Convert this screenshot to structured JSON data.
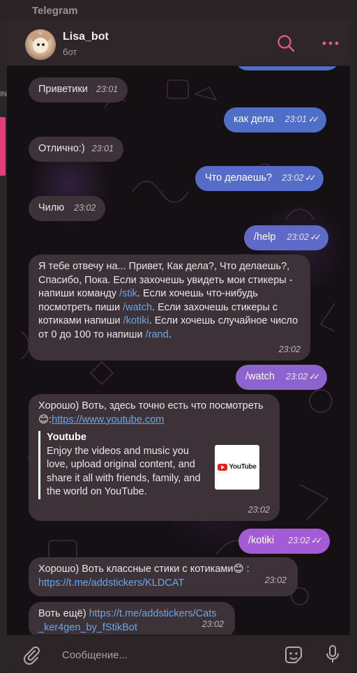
{
  "app": {
    "title": "Telegram"
  },
  "header": {
    "name": "Lisa_bot",
    "status": "бот",
    "search_icon": "search-icon",
    "menu_icon": "more-icon"
  },
  "colors": {
    "out_blue": "#4f6ec7",
    "out_purple": "#7a63c8",
    "out_violet": "#9f5cd4",
    "out_magenta": "#b45ed8",
    "incoming": "#3c3238",
    "accent_pink": "#e0407a"
  },
  "messages": [
    {
      "dir": "in",
      "text": "Приветики",
      "time": "23:01"
    },
    {
      "dir": "out",
      "text": "как дела",
      "time": "23:01"
    },
    {
      "dir": "in",
      "text": "Отлично:)",
      "time": "23:01"
    },
    {
      "dir": "out",
      "text": "Что делаешь?",
      "time": "23:02"
    },
    {
      "dir": "in",
      "text": "Чилю",
      "time": "23:02"
    },
    {
      "dir": "out",
      "text": "/help",
      "time": "23:02"
    },
    {
      "dir": "in",
      "time": "23:02",
      "parts": {
        "p1": "Я тебе отвечу на... Привет, Как дела?, Что делаешь?, Спасибо, Пока.  Если захочешь увидеть мои стикеры - напиши команду ",
        "c1": "/stik",
        "p2": ". Если хочешь что-нибудь посмотреть пиши ",
        "c2": "/watch",
        "p3": ". Если захочешь стикеры с котиками напиши ",
        "c3": "/kotiki",
        "p4": ". Если хочешь случайное число от 0 до 100 то напиши ",
        "c4": "/rand",
        "p5": "."
      }
    },
    {
      "dir": "out",
      "text": "/watch",
      "time": "23:02"
    },
    {
      "dir": "in",
      "time": "23:02",
      "text": "Хорошо) Воть, здесь точно есть что посмотреть",
      "emoji": "😊",
      "sep": ":",
      "url": "https://www.youtube.com",
      "preview": {
        "title": "Youtube",
        "description": "Enjoy the videos and music you love, upload original content, and share it all with friends, family, and the world on YouTube.",
        "logo_text": "YouTube"
      }
    },
    {
      "dir": "out",
      "text": "/kotiki",
      "time": "23:02"
    },
    {
      "dir": "in",
      "time": "23:02",
      "text": "Хорошо) Воть классные стики с котиками",
      "emoji": "😊",
      "sep": " :",
      "url": "https://t.me/addstickers/KLDCAT"
    },
    {
      "dir": "in",
      "time": "23:02",
      "text": "Воть ещё) ",
      "url": "https://t.me/addstickers/Cats_ker4gen_by_fStikBot"
    }
  ],
  "composer": {
    "placeholder": "Сообщение...",
    "attach_icon": "paperclip-icon",
    "sticker_icon": "sticker-icon",
    "mic_icon": "microphone-icon"
  },
  "sidebar": {
    "partial_label": "IN"
  }
}
